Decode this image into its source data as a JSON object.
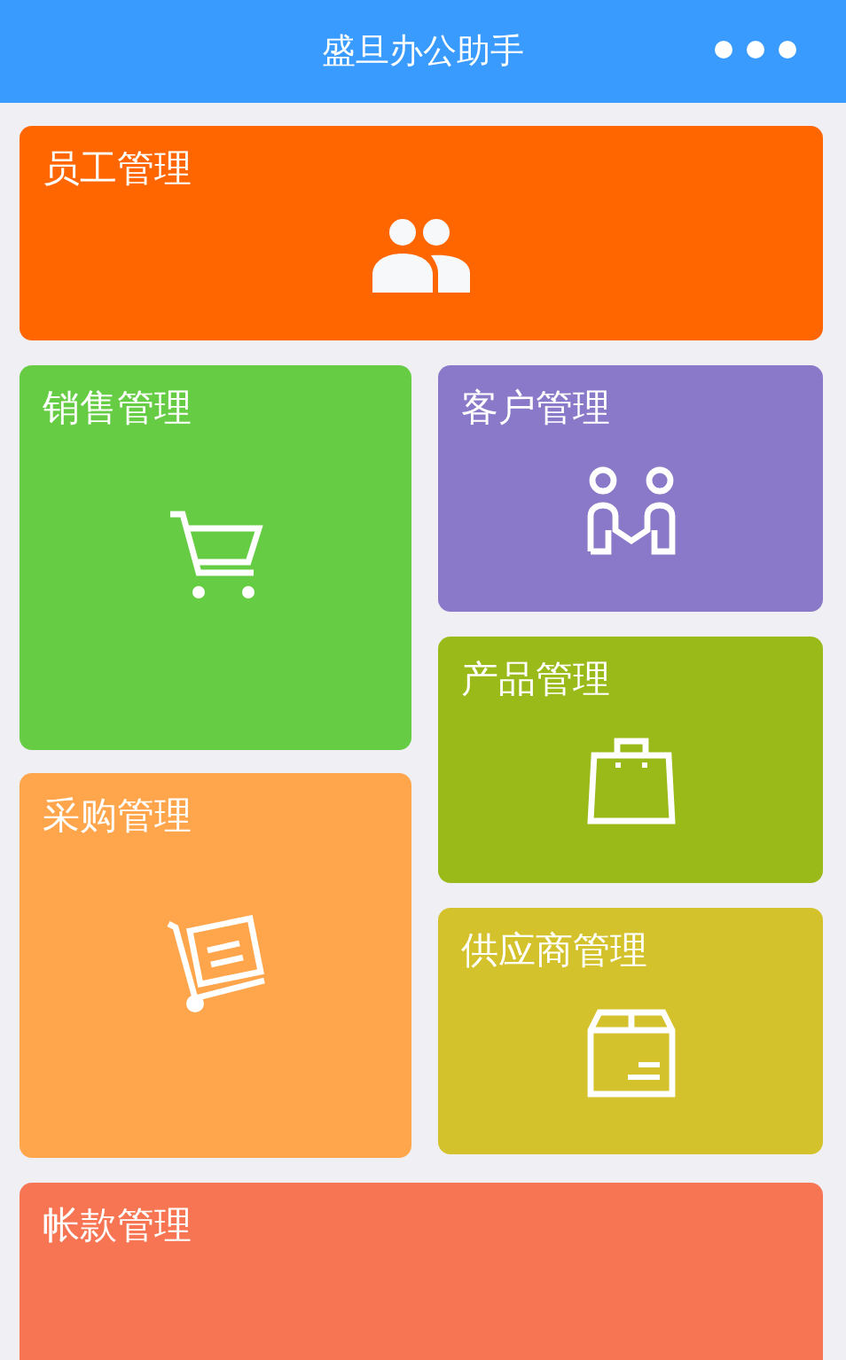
{
  "header": {
    "title": "盛旦办公助手"
  },
  "top_tile": {
    "label": "员工管理",
    "kind": "people",
    "color": "#ff6600"
  },
  "left_column": [
    {
      "label": "销售管理",
      "kind": "cart",
      "color": "#66cc44"
    },
    {
      "label": "采购管理",
      "kind": "trolley",
      "color": "#ffa54c"
    }
  ],
  "right_column": [
    {
      "label": "客户管理",
      "kind": "handshake",
      "color": "#8a78c8"
    },
    {
      "label": "产品管理",
      "kind": "bag",
      "color": "#9aba1a"
    },
    {
      "label": "供应商管理",
      "kind": "box",
      "color": "#d4c22c"
    }
  ],
  "bottom_tile": {
    "label": "帐款管理",
    "color": "#f77553"
  }
}
